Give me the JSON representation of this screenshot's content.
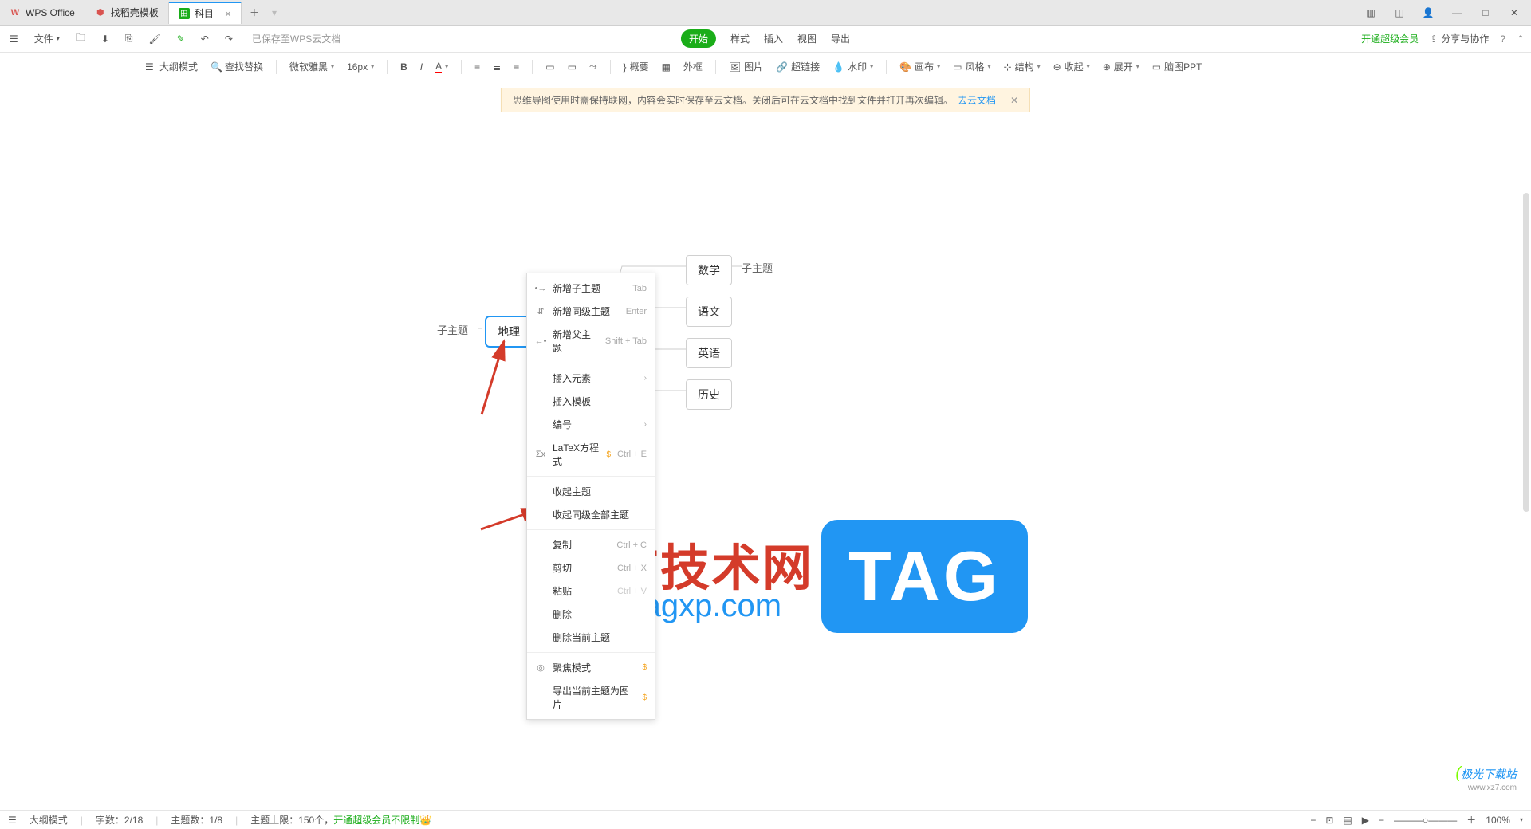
{
  "titlebar": {
    "tabs": [
      {
        "icon": "W",
        "icon_color": "#d9534f",
        "label": "WPS Office"
      },
      {
        "icon": "⬡",
        "icon_color": "#d9534f",
        "label": "找稻壳模板"
      },
      {
        "icon": "◧",
        "icon_color": "#1aad19",
        "label": "科目",
        "active": true
      }
    ]
  },
  "menurow": {
    "file": "文件",
    "savestatus": "已保存至WPS云文档",
    "center": {
      "start": "开始",
      "format": "样式",
      "insert": "插入",
      "view": "视图",
      "export": "导出"
    },
    "vip": "开通超级会员",
    "share": "分享与协作"
  },
  "toolbar": {
    "outline": "大纲模式",
    "findreplace": "查找替换",
    "font": "微软雅黑",
    "size": "16px",
    "summary": "概要",
    "frame": "外框",
    "image": "图片",
    "hyperlink": "超链接",
    "watermark": "水印",
    "canvas": "画布",
    "style": "风格",
    "structure": "结构",
    "collapse": "收起",
    "expand": "展开",
    "brainppt": "脑图PPT"
  },
  "infobar": {
    "text": "思维导图使用时需保持联网，内容会实时保存至云文档。关闭后可在云文档中找到文件并打开再次编辑。",
    "link": "去云文档"
  },
  "mindmap": {
    "left_child": "子主题",
    "root": "地理",
    "nodes": [
      {
        "label": "数学",
        "child": "子主题"
      },
      {
        "label": "语文"
      },
      {
        "label": "英语"
      },
      {
        "label": "历史"
      }
    ]
  },
  "ctxmenu": {
    "add_child": "新增子主题",
    "add_child_key": "Tab",
    "add_sibling": "新增同级主题",
    "add_sibling_key": "Enter",
    "add_parent": "新增父主题",
    "add_parent_key": "Shift + Tab",
    "insert_elem": "插入元素",
    "insert_tpl": "插入模板",
    "numbering": "编号",
    "latex": "LaTeX方程式",
    "latex_key": "Ctrl + E",
    "collapse_topic": "收起主题",
    "collapse_siblings": "收起同级全部主题",
    "copy": "复制",
    "copy_key": "Ctrl + C",
    "cut": "剪切",
    "cut_key": "Ctrl + X",
    "paste": "粘贴",
    "paste_key": "Ctrl + V",
    "delete": "删除",
    "delete_cur": "删除当前主题",
    "focus": "聚焦模式",
    "export_img": "导出当前主题为图片"
  },
  "watermark": {
    "text": "电脑技术网",
    "url": "www.tagxp.com",
    "tag": "TAG",
    "small": "极光下载站",
    "sub": "www.xz7.com"
  },
  "statusbar": {
    "outline": "大纲模式",
    "words": "字数：2/18",
    "topics": "主题数：1/8",
    "limit": "主题上限：150个，",
    "unlimit": "开通超级会员不限制",
    "zoom": "100%"
  }
}
